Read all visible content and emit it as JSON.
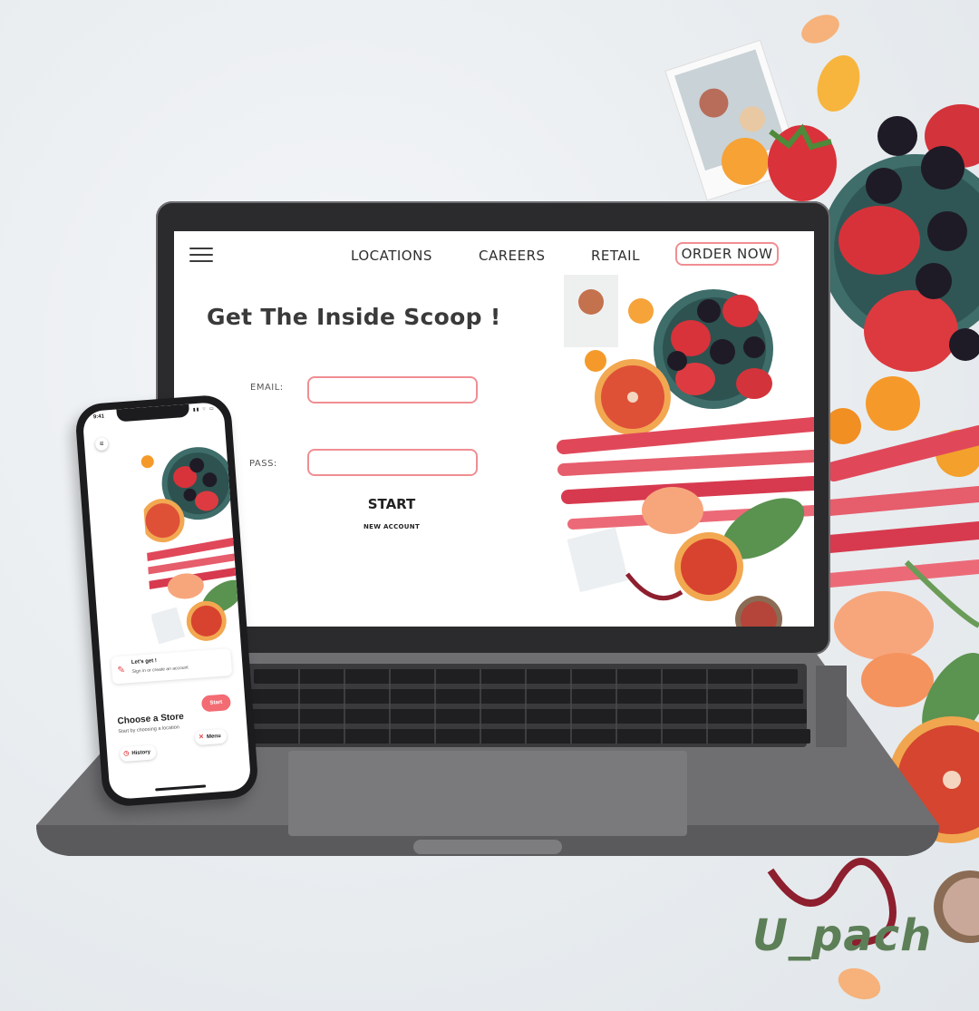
{
  "nav": {
    "links": [
      "LOCATIONS",
      "CAREERS",
      "RETAIL"
    ],
    "order_label": "ORDER NOW"
  },
  "login": {
    "headline": "Get The Inside Scoop !",
    "email_label": "EMAIL:",
    "pass_label": "PASS:",
    "email_value": "",
    "pass_value": "",
    "start_label": "START",
    "new_account_label": "NEW ACCOUNT"
  },
  "phone": {
    "time": "9:41",
    "status_icons": "signal-icon wifi-icon battery-icon",
    "card_title": "Let's get !",
    "card_sub": "Sign in or create an account",
    "store_title": "Choose a Store",
    "store_sub": "Start by choosing a location",
    "start_label": "Start",
    "history_label": "History",
    "menu_label": "Menu"
  },
  "brand": {
    "watermark": "U_pach",
    "accent": "#f08e92",
    "button_red": "#f36b73",
    "watermark_color": "#5d7f57"
  }
}
